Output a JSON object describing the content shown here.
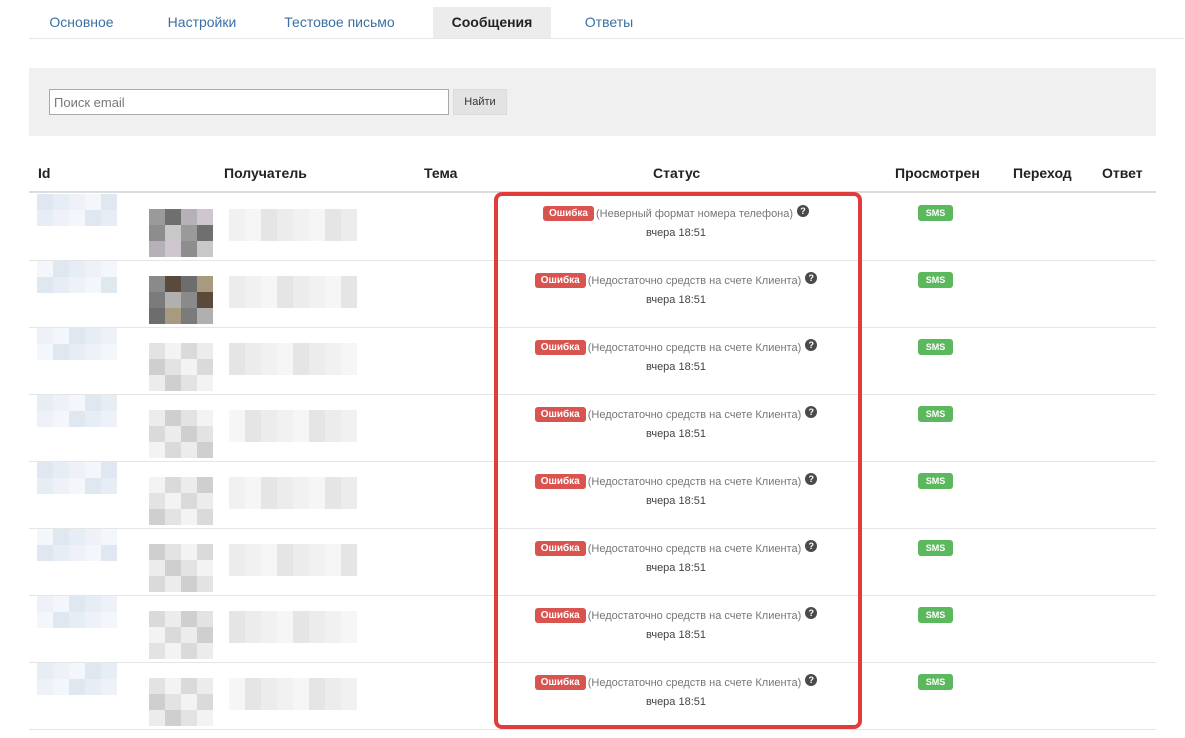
{
  "tabs": [
    {
      "label": "Основное",
      "active": false
    },
    {
      "label": "Настройки",
      "active": false
    },
    {
      "label": "Тестовое письмо",
      "active": false
    },
    {
      "label": "Сообщения",
      "active": true
    },
    {
      "label": "Ответы",
      "active": false
    }
  ],
  "search": {
    "placeholder": "Поиск email",
    "value": "",
    "button_label": "Найти"
  },
  "table": {
    "columns": [
      "Id",
      "Получатель",
      "Тема",
      "Статус",
      "Просмотрен",
      "Переход",
      "Ответ"
    ],
    "rows": [
      {
        "status_badge": "Ошибка",
        "status_reason": "(Неверный формат номера телефона)",
        "time": "вчера 18:51",
        "viewed_badge": "SMS"
      },
      {
        "status_badge": "Ошибка",
        "status_reason": "(Недостаточно средств на счете Клиента)",
        "time": "вчера 18:51",
        "viewed_badge": "SMS"
      },
      {
        "status_badge": "Ошибка",
        "status_reason": "(Недостаточно средств на счете Клиента)",
        "time": "вчера 18:51",
        "viewed_badge": "SMS"
      },
      {
        "status_badge": "Ошибка",
        "status_reason": "(Недостаточно средств на счете Клиента)",
        "time": "вчера 18:51",
        "viewed_badge": "SMS"
      },
      {
        "status_badge": "Ошибка",
        "status_reason": "(Недостаточно средств на счете Клиента)",
        "time": "вчера 18:51",
        "viewed_badge": "SMS"
      },
      {
        "status_badge": "Ошибка",
        "status_reason": "(Недостаточно средств на счете Клиента)",
        "time": "вчера 18:51",
        "viewed_badge": "SMS"
      },
      {
        "status_badge": "Ошибка",
        "status_reason": "(Недостаточно средств на счете Клиента)",
        "time": "вчера 18:51",
        "viewed_badge": "SMS"
      },
      {
        "status_badge": "Ошибка",
        "status_reason": "(Недостаточно средств на счете Клиента)",
        "time": "вчера 18:51",
        "viewed_badge": "SMS"
      }
    ]
  },
  "colors": {
    "error": "#d9534f",
    "success": "#5cb85c",
    "link": "#3a6fa5",
    "highlight": "#e03c3c"
  },
  "icons": {
    "help": "question-circle-icon"
  }
}
